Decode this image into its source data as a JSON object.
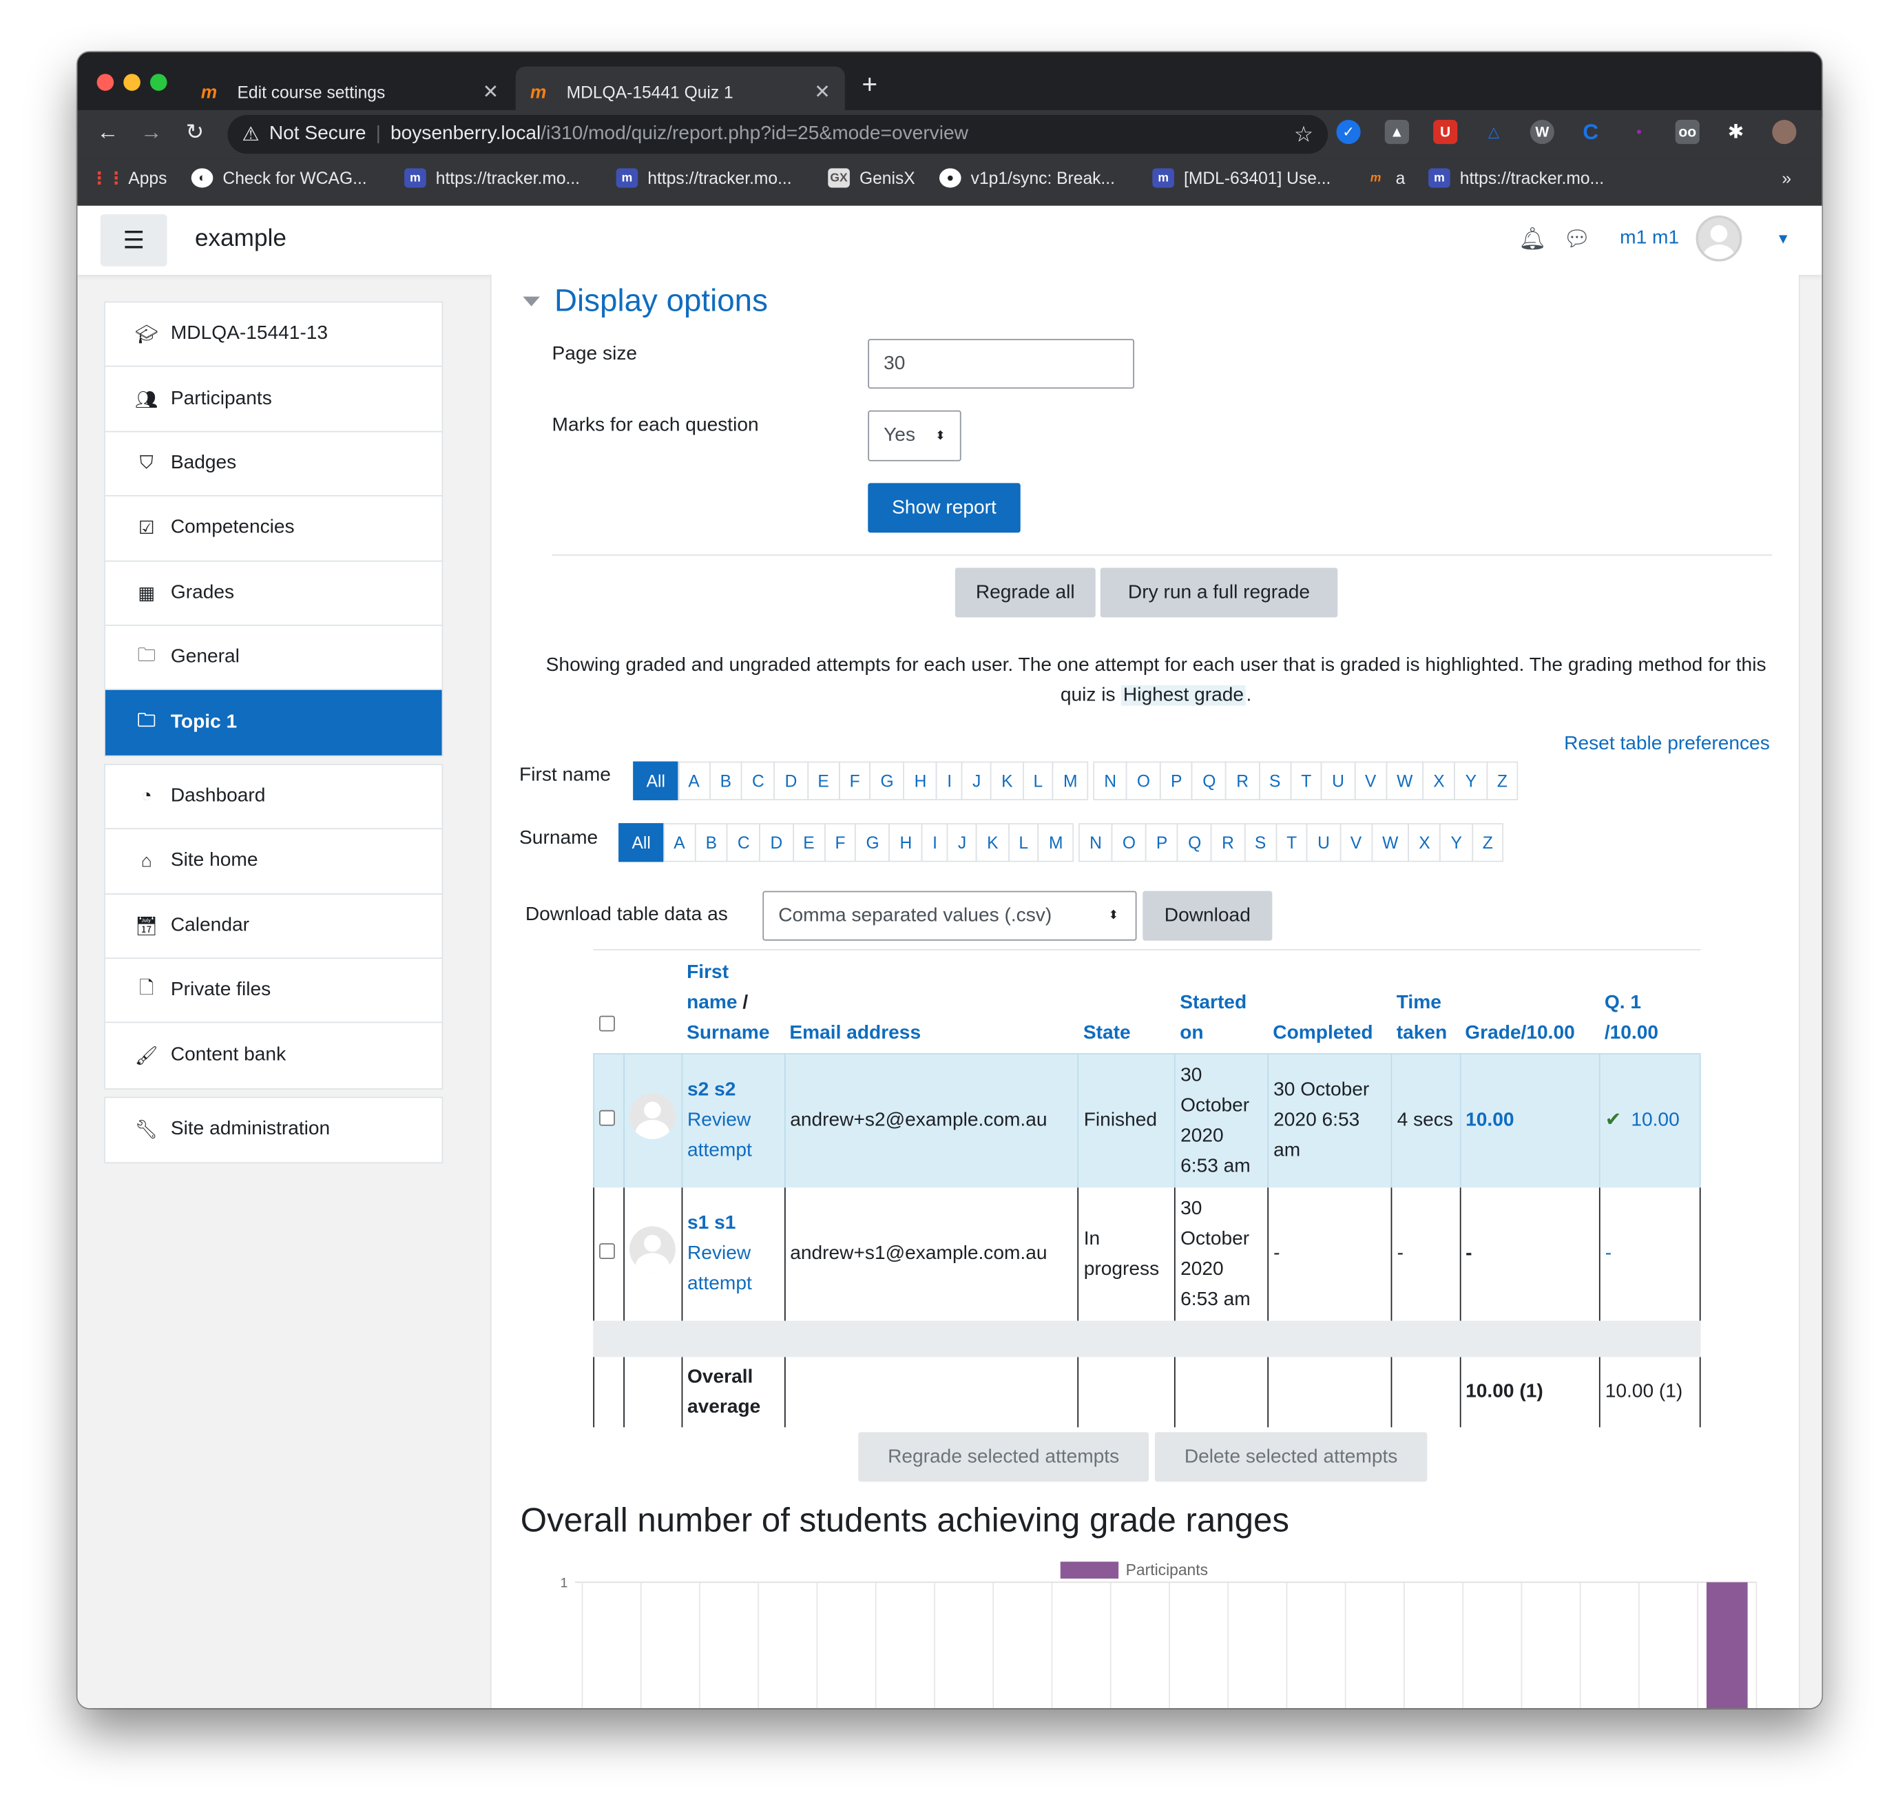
{
  "browser": {
    "tabs": [
      {
        "title": "Edit course settings"
      },
      {
        "title": "MDLQA-15441 Quiz 1"
      }
    ],
    "address": {
      "security": "Not Secure",
      "host": "boysenberry.local",
      "path": "/i310/mod/quiz/report.php?id=25&mode=overview"
    },
    "bookmarks": [
      "Apps",
      "Check for WCAG...",
      "https://tracker.mo...",
      "https://tracker.mo...",
      "GenisX",
      "v1p1/sync: Break...",
      "[MDL-63401] Use...",
      "a",
      "https://tracker.mo..."
    ],
    "more": "»"
  },
  "header": {
    "site_name": "example",
    "user_name": "m1 m1"
  },
  "sidebar": {
    "group1": [
      {
        "label": "MDLQA-15441-13",
        "icon": "graduation-cap-icon"
      },
      {
        "label": "Participants",
        "icon": "users-icon"
      },
      {
        "label": "Badges",
        "icon": "shield-icon"
      },
      {
        "label": "Competencies",
        "icon": "check-square-icon"
      },
      {
        "label": "Grades",
        "icon": "table-icon"
      },
      {
        "label": "General",
        "icon": "folder-icon"
      },
      {
        "label": "Topic 1",
        "icon": "folder-icon",
        "active": true
      }
    ],
    "group2": [
      {
        "label": "Dashboard",
        "icon": "dashboard-icon"
      },
      {
        "label": "Site home",
        "icon": "home-icon"
      },
      {
        "label": "Calendar",
        "icon": "calendar-icon"
      },
      {
        "label": "Private files",
        "icon": "file-icon"
      },
      {
        "label": "Content bank",
        "icon": "brush-icon"
      }
    ],
    "group3": [
      {
        "label": "Site administration",
        "icon": "wrench-icon"
      }
    ]
  },
  "display_options": {
    "heading": "Display options",
    "page_size_label": "Page size",
    "page_size_value": "30",
    "marks_label": "Marks for each question",
    "marks_value": "Yes",
    "show_report": "Show report"
  },
  "regrade": {
    "regrade_all": "Regrade all",
    "dry_run": "Dry run a full regrade"
  },
  "info": {
    "text1": "Showing graded and ungraded attempts for each user. The one attempt for each user that is graded is highlighted. The grading method for this quiz is ",
    "method": "Highest grade",
    "text2": "."
  },
  "reset_prefs": "Reset table preferences",
  "initials": {
    "first_label": "First name",
    "surname_label": "Surname",
    "letters": [
      "All",
      "A",
      "B",
      "C",
      "D",
      "E",
      "F",
      "G",
      "H",
      "I",
      "J",
      "K",
      "L",
      "M",
      "N",
      "O",
      "P",
      "Q",
      "R",
      "S",
      "T",
      "U",
      "V",
      "W",
      "X",
      "Y",
      "Z"
    ]
  },
  "download": {
    "label": "Download table data as",
    "format": "Comma separated values (.csv)",
    "button": "Download"
  },
  "table": {
    "headers": {
      "name_first": "First",
      "name_mid": "name",
      "name_slash": " /",
      "name_last": "Surname",
      "email": "Email address",
      "state": "State",
      "started_1": "Started",
      "started_2": "on",
      "completed": "Completed",
      "time_1": "Time",
      "time_2": "taken",
      "grade": "Grade/10.00",
      "q1_1": "Q. 1",
      "q1_2": "/10.00"
    },
    "rows": [
      {
        "name": "s2 s2",
        "review": "Review attempt",
        "email": "andrew+s2@example.com.au",
        "state": "Finished",
        "started": "30 October 2020 6:53 am",
        "completed": "30 October 2020 6:53 am",
        "time": "4 secs",
        "grade": "10.00",
        "q1": "10.00"
      },
      {
        "name": "s1 s1",
        "review": "Review attempt",
        "email": "andrew+s1@example.com.au",
        "state": "In progress",
        "started": "30 October 2020 6:53 am",
        "completed": "-",
        "time": "-",
        "grade": "-",
        "q1": "-"
      }
    ],
    "overall_label": "Overall average",
    "overall_grade": "10.00 (1)",
    "overall_q1": "10.00 (1)"
  },
  "actions": {
    "regrade_selected": "Regrade selected attempts",
    "delete_selected": "Delete selected attempts"
  },
  "chart_data": {
    "type": "bar",
    "title": "Overall number of students achieving grade ranges",
    "series": [
      {
        "name": "Participants",
        "values": [
          0,
          0,
          0,
          0,
          0,
          0,
          0,
          0,
          0,
          0,
          0,
          0,
          0,
          0,
          0,
          0,
          0,
          0,
          0,
          1
        ]
      }
    ],
    "ylim": [
      0,
      1
    ],
    "ytick_visible": "1",
    "color": "#8b5a96"
  }
}
